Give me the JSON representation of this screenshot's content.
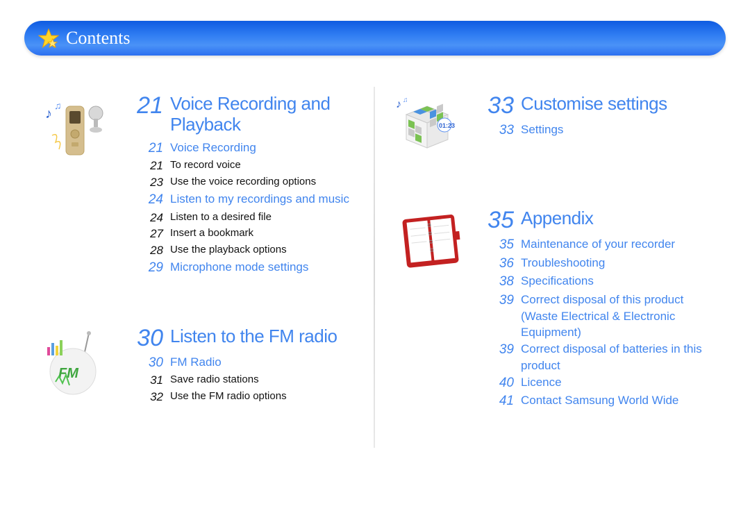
{
  "header": {
    "title": "Contents"
  },
  "left": {
    "chapters": [
      {
        "page": "21",
        "title": "Voice Recording and Playback",
        "items": [
          {
            "page": "21",
            "title": "Voice Recording",
            "level": "blue"
          },
          {
            "page": "21",
            "title": "To record voice",
            "level": "black"
          },
          {
            "page": "23",
            "title": "Use the voice recording options",
            "level": "black"
          },
          {
            "page": "24",
            "title": "Listen to my recordings and music",
            "level": "blue"
          },
          {
            "page": "24",
            "title": "Listen to a desired file",
            "level": "black"
          },
          {
            "page": "27",
            "title": "Insert a bookmark",
            "level": "black"
          },
          {
            "page": "28",
            "title": "Use the playback options",
            "level": "black"
          },
          {
            "page": "29",
            "title": "Microphone mode settings",
            "level": "blue"
          }
        ]
      },
      {
        "page": "30",
        "title": "Listen to the FM radio",
        "items": [
          {
            "page": "30",
            "title": "FM Radio",
            "level": "blue"
          },
          {
            "page": "31",
            "title": "Save radio stations",
            "level": "black"
          },
          {
            "page": "32",
            "title": "Use the FM radio options",
            "level": "black"
          }
        ]
      }
    ]
  },
  "right": {
    "chapters": [
      {
        "page": "33",
        "title": "Customise settings",
        "items": [
          {
            "page": "33",
            "title": "Settings",
            "level": "blue"
          }
        ]
      },
      {
        "page": "35",
        "title": "Appendix",
        "items": [
          {
            "page": "35",
            "title": "Maintenance of your recorder",
            "level": "blue"
          },
          {
            "page": "36",
            "title": "Troubleshooting",
            "level": "blue"
          },
          {
            "page": "38",
            "title": "Specifications",
            "level": "blue"
          },
          {
            "page": "39",
            "title": "Correct disposal of this product (Waste Electrical & Electronic Equipment)",
            "level": "blue"
          },
          {
            "page": "39",
            "title": "Correct disposal of batteries in this product",
            "level": "blue"
          },
          {
            "page": "40",
            "title": "Licence",
            "level": "blue"
          },
          {
            "page": "41",
            "title": "Contact Samsung World Wide",
            "level": "blue"
          }
        ]
      }
    ]
  }
}
